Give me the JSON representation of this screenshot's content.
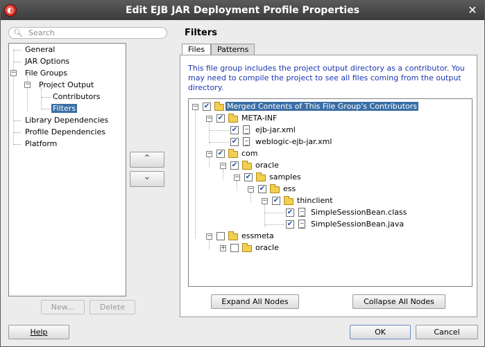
{
  "window": {
    "title": "Edit EJB JAR Deployment Profile Properties",
    "close": "✕"
  },
  "search": {
    "placeholder": "Search"
  },
  "nav": {
    "items": [
      "General",
      "JAR Options",
      "File Groups",
      "Project Output",
      "Contributors",
      "Filters",
      "Library Dependencies",
      "Profile Dependencies",
      "Platform"
    ],
    "selected": "Filters"
  },
  "left_buttons": {
    "new_label": "New...",
    "delete_label": "Delete"
  },
  "arrows": {
    "up": "⌃",
    "down": "⌄"
  },
  "panel": {
    "title": "Filters",
    "tabs": [
      "Files",
      "Patterns"
    ],
    "active_tab": "Files",
    "info": "This file group includes the project output directory as a contributor.  You may need to compile the project to see all files coming from the output directory."
  },
  "file_tree": [
    {
      "label": "Merged Contents of This File Group's Contributors",
      "type": "folder",
      "checked": true,
      "expander": "−"
    },
    {
      "label": "META-INF",
      "type": "folder",
      "checked": true,
      "expander": "−"
    },
    {
      "label": "ejb-jar.xml",
      "type": "file",
      "checked": true
    },
    {
      "label": "weblogic-ejb-jar.xml",
      "type": "file",
      "checked": true
    },
    {
      "label": "com",
      "type": "folder",
      "checked": true,
      "expander": "−"
    },
    {
      "label": "oracle",
      "type": "folder",
      "checked": true,
      "expander": "−"
    },
    {
      "label": "samples",
      "type": "folder",
      "checked": true,
      "expander": "−"
    },
    {
      "label": "ess",
      "type": "folder",
      "checked": true,
      "expander": "−"
    },
    {
      "label": "thinclient",
      "type": "folder",
      "checked": true,
      "expander": "−"
    },
    {
      "label": "SimpleSessionBean.class",
      "type": "file",
      "checked": true
    },
    {
      "label": "SimpleSessionBean.java",
      "type": "file",
      "checked": true
    },
    {
      "label": "essmeta",
      "type": "folder",
      "checked": false,
      "expander": "−"
    },
    {
      "label": "oracle",
      "type": "folder",
      "checked": false,
      "expander": "+"
    }
  ],
  "tree_buttons": {
    "expand": "Expand All Nodes",
    "collapse": "Collapse All Nodes"
  },
  "footer": {
    "help": "Help",
    "ok": "OK",
    "cancel": "Cancel"
  },
  "colors": {
    "selection": "#3a6ea5",
    "info_text": "#1b35b0",
    "titlebar": "#3b3b3b"
  }
}
